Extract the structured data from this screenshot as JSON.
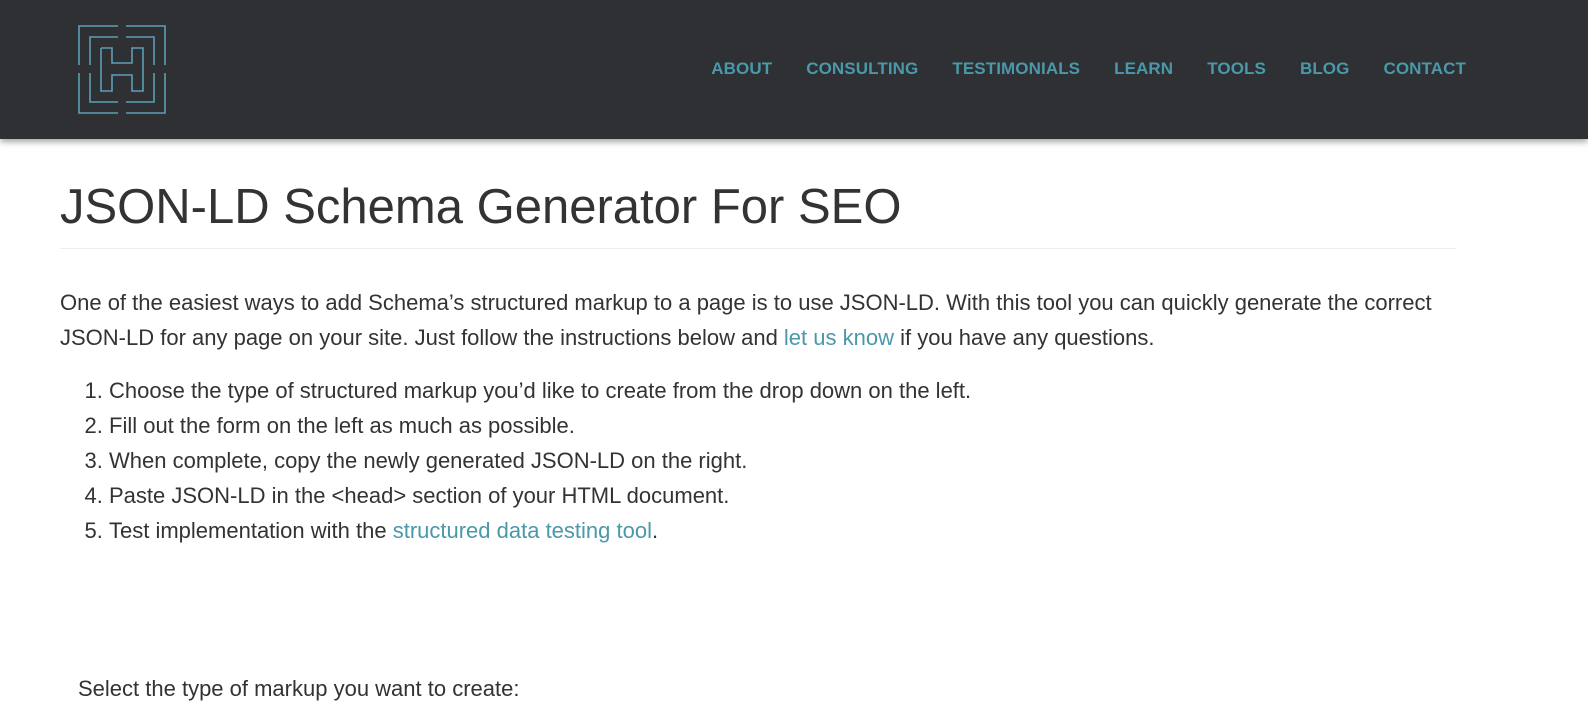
{
  "header": {
    "logo_icon": "hreflang-logo-icon",
    "brand_color": "#4a98a9",
    "background_color": "#2e3034",
    "nav": [
      {
        "label": "ABOUT"
      },
      {
        "label": "CONSULTING"
      },
      {
        "label": "TESTIMONIALS"
      },
      {
        "label": "LEARN"
      },
      {
        "label": "TOOLS"
      },
      {
        "label": "BLOG"
      },
      {
        "label": "CONTACT"
      }
    ]
  },
  "main": {
    "title": "JSON-LD Schema Generator For SEO",
    "intro": {
      "before_link": "One of the easiest ways to add Schema’s structured markup to a page is to use JSON-LD. With this tool you can quickly generate the correct JSON-LD for any page on your site. Just follow the instructions below and ",
      "link_text": "let us know",
      "after_link": " if you have any questions."
    },
    "steps": [
      {
        "text": "Choose the type of structured markup you’d like to create from the drop down on the left."
      },
      {
        "text": "Fill out the form on the left as much as possible."
      },
      {
        "text": "When complete, copy the newly generated JSON-LD on the right."
      },
      {
        "text": "Paste JSON-LD in the <head> section of your HTML document."
      },
      {
        "text": "Test implementation with the ",
        "link_text": "structured data testing tool",
        "after_link": "."
      }
    ],
    "select_label": "Select the type of markup you want to create:"
  }
}
